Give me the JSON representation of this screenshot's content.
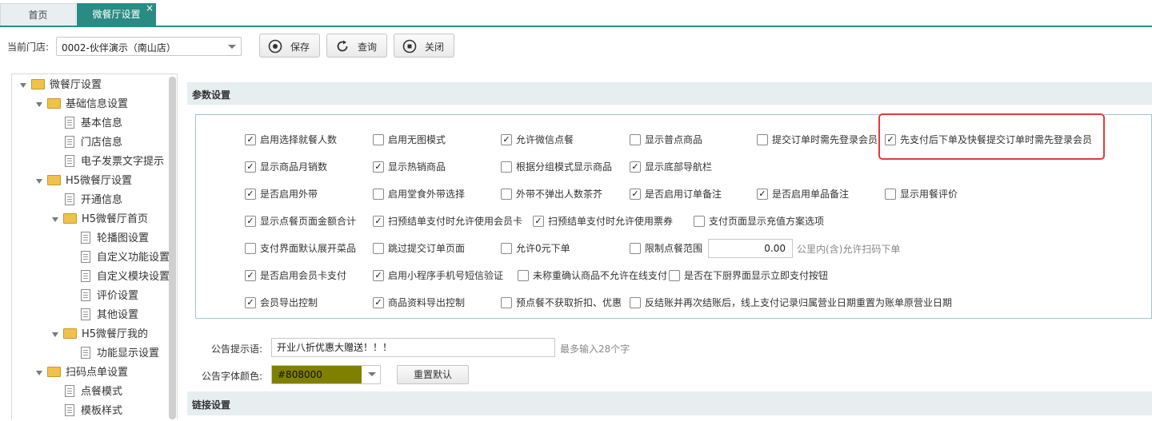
{
  "tabs": [
    {
      "label": "首页"
    },
    {
      "label": "微餐厅设置",
      "close": "×"
    }
  ],
  "toolbar": {
    "store_label": "当前门店:",
    "store_value": "0002-伙伴演示（南山店）",
    "save_label": "保存",
    "query_label": "查询",
    "close_label": "关闭"
  },
  "sidebar": {
    "items": [
      {
        "label": "微餐厅设置"
      },
      {
        "label": "基础信息设置"
      },
      {
        "label": "基本信息"
      },
      {
        "label": "门店信息"
      },
      {
        "label": "电子发票文字提示"
      },
      {
        "label": "H5微餐厅设置"
      },
      {
        "label": "开通信息"
      },
      {
        "label": "H5微餐厅首页"
      },
      {
        "label": "轮播图设置"
      },
      {
        "label": "自定义功能设置"
      },
      {
        "label": "自定义模块设置"
      },
      {
        "label": "评价设置"
      },
      {
        "label": "其他设置"
      },
      {
        "label": "H5微餐厅我的"
      },
      {
        "label": "功能显示设置"
      },
      {
        "label": "扫码点单设置"
      },
      {
        "label": "点餐模式"
      },
      {
        "label": "模板样式"
      }
    ]
  },
  "params": {
    "title": "参数设置",
    "options": [
      {
        "label": "启用选择就餐人数",
        "checked": true
      },
      {
        "label": "启用无图模式",
        "checked": false
      },
      {
        "label": "允许微信点餐",
        "checked": true
      },
      {
        "label": "显示普点商品",
        "checked": false
      },
      {
        "label": "提交订单时需先登录会员",
        "checked": false
      },
      {
        "label": "先支付后下单及快餐提交订单时需先登录会员",
        "checked": true
      },
      {
        "label": "显示商品月销数",
        "checked": true
      },
      {
        "label": "显示热销商品",
        "checked": true
      },
      {
        "label": "根据分组模式显示商品",
        "checked": false
      },
      {
        "label": "显示底部导航栏",
        "checked": true
      },
      {
        "label": "是否启用外带",
        "checked": true
      },
      {
        "label": "启用堂食外带选择",
        "checked": false
      },
      {
        "label": "外带不弹出人数茶芥",
        "checked": false
      },
      {
        "label": "是否启用订单备注",
        "checked": true
      },
      {
        "label": "是否启用单品备注",
        "checked": true
      },
      {
        "label": "显示用餐评价",
        "checked": false
      },
      {
        "label": "显示点餐页面金额合计",
        "checked": true
      },
      {
        "label": "扫预结单支付时允许使用会员卡",
        "checked": true
      },
      {
        "label": "扫预结单支付时允许使用票券",
        "checked": true
      },
      {
        "label": "支付页面显示充值方案选项",
        "checked": false
      },
      {
        "label": "支付界面默认展开菜品",
        "checked": false
      },
      {
        "label": "跳过提交订单页面",
        "checked": false
      },
      {
        "label": "允许0元下单",
        "checked": false
      },
      {
        "label": "限制点餐范围",
        "checked": false
      },
      {
        "label": "是否启用会员卡支付",
        "checked": true
      },
      {
        "label": "启用小程序手机号短信验证",
        "checked": true
      },
      {
        "label": "未称重确认商品不允许在线支付",
        "checked": false
      },
      {
        "label": "是否在下厨界面显示立即支付按钮",
        "checked": false
      },
      {
        "label": "会员导出控制",
        "checked": true
      },
      {
        "label": "商品资料导出控制",
        "checked": true
      },
      {
        "label": "预点餐不获取折扣、优惠",
        "checked": false
      },
      {
        "label": "反结账并再次结账后，线上支付记录归属营业日期重置为账单原营业日期",
        "checked": false
      }
    ],
    "range_value": "0.00",
    "range_note": "公里内(含)允许扫码下单"
  },
  "notice": {
    "label": "公告提示语:",
    "value": "开业八折优惠大赠送！！！",
    "tip": "最多输入28个字",
    "color_label": "公告字体颜色:",
    "color_value": "#808000",
    "reset_label": "重置默认"
  },
  "link_section": {
    "title": "链接设置"
  }
}
